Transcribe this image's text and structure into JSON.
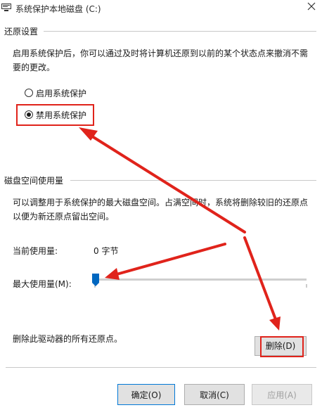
{
  "window": {
    "title": "系统保护本地磁盘 (C:)"
  },
  "restore": {
    "section_title": "还原设置",
    "description": "启用系统保护后，你可以通过及时将计算机还原到以前的某个状态点来撤消不需要的更改。",
    "options": [
      {
        "label": "启用系统保护",
        "selected": false
      },
      {
        "label": "禁用系统保护",
        "selected": true
      }
    ]
  },
  "disk": {
    "section_title": "磁盘空间使用量",
    "description": "可以调整用于系统保护的最大磁盘空间。占满空间时，系统将删除较旧的还原点以便为新还原点留出空间。",
    "current_usage_label": "当前使用量:",
    "current_usage_value": "0 字节",
    "max_usage_label": "最大使用量(M):",
    "max_usage_fraction": 0.0,
    "delete_text": "删除此驱动器的所有还原点。",
    "delete_button": "删除(D)"
  },
  "footer": {
    "ok": "确定(O)",
    "cancel": "取消(C)",
    "apply": "应用(A)"
  },
  "colors": {
    "annotation_red": "#e0231b",
    "slider_thumb": "#0067c0",
    "accent": "#0078d7"
  }
}
